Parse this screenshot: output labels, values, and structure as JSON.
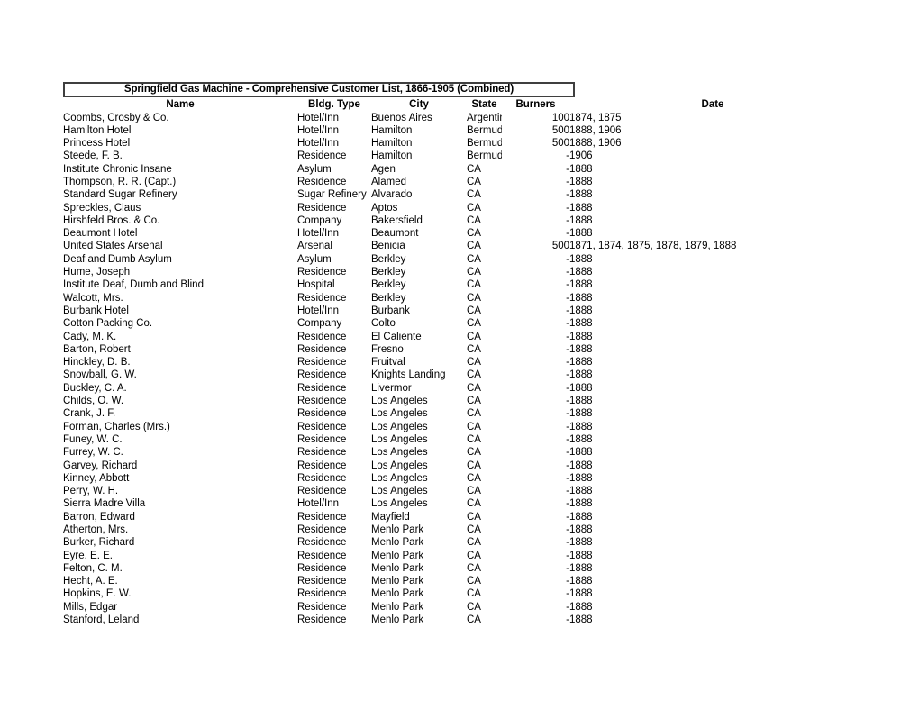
{
  "document": {
    "title": "Springfield Gas Machine - Comprehensive Customer List, 1866-1905 (Combined)"
  },
  "table": {
    "columns": [
      {
        "key": "name",
        "label": "Name"
      },
      {
        "key": "type",
        "label": "Bldg. Type"
      },
      {
        "key": "city",
        "label": "City"
      },
      {
        "key": "state",
        "label": "State"
      },
      {
        "key": "burners",
        "label": "Burners"
      },
      {
        "key": "date",
        "label": "Date"
      }
    ],
    "rows": [
      {
        "name": "Coombs, Crosby & Co.",
        "type": "Hotel/Inn",
        "city": "Buenos Aires",
        "state": "Argentina",
        "burners": "100",
        "date": "1874, 1875"
      },
      {
        "name": "Hamilton Hotel",
        "type": "Hotel/Inn",
        "city": "Hamilton",
        "state": "Bermuda",
        "burners": "500",
        "date": "1888, 1906"
      },
      {
        "name": "Princess Hotel",
        "type": "Hotel/Inn",
        "city": "Hamilton",
        "state": "Bermuda",
        "burners": "500",
        "date": "1888, 1906"
      },
      {
        "name": "Steede, F. B.",
        "type": "Residence",
        "city": "Hamilton",
        "state": "Bermuda",
        "burners": "-",
        "date": "1906"
      },
      {
        "name": "Institute Chronic Insane",
        "type": "Asylum",
        "city": "Agen",
        "state": "CA",
        "burners": "-",
        "date": "1888"
      },
      {
        "name": "Thompson, R. R. (Capt.)",
        "type": "Residence",
        "city": "Alamed",
        "state": "CA",
        "burners": "-",
        "date": "1888"
      },
      {
        "name": "Standard Sugar Refinery",
        "type": "Sugar Refinery",
        "city": "Alvarado",
        "state": "CA",
        "burners": "-",
        "date": "1888"
      },
      {
        "name": "Spreckles, Claus",
        "type": "Residence",
        "city": "Aptos",
        "state": "CA",
        "burners": "-",
        "date": "1888"
      },
      {
        "name": "Hirshfeld Bros. & Co.",
        "type": "Company",
        "city": "Bakersfield",
        "state": "CA",
        "burners": "-",
        "date": "1888"
      },
      {
        "name": "Beaumont Hotel",
        "type": "Hotel/Inn",
        "city": "Beaumont",
        "state": "CA",
        "burners": "-",
        "date": "1888"
      },
      {
        "name": "United States Arsenal",
        "type": "Arsenal",
        "city": "Benicia",
        "state": "CA",
        "burners": "500",
        "date": "1871, 1874, 1875, 1878, 1879, 1888"
      },
      {
        "name": "Deaf and Dumb Asylum",
        "type": "Asylum",
        "city": "Berkley",
        "state": "CA",
        "burners": "-",
        "date": "1888"
      },
      {
        "name": "Hume, Joseph",
        "type": "Residence",
        "city": "Berkley",
        "state": "CA",
        "burners": "-",
        "date": "1888"
      },
      {
        "name": "Institute Deaf, Dumb and Blind",
        "type": "Hospital",
        "city": "Berkley",
        "state": "CA",
        "burners": "-",
        "date": "1888"
      },
      {
        "name": "Walcott, Mrs.",
        "type": "Residence",
        "city": "Berkley",
        "state": "CA",
        "burners": "-",
        "date": "1888"
      },
      {
        "name": "Burbank Hotel",
        "type": "Hotel/Inn",
        "city": "Burbank",
        "state": "CA",
        "burners": "-",
        "date": "1888"
      },
      {
        "name": "Cotton Packing Co.",
        "type": "Company",
        "city": "Colto",
        "state": "CA",
        "burners": "-",
        "date": "1888"
      },
      {
        "name": "Cady, M. K.",
        "type": "Residence",
        "city": "El Caliente",
        "state": "CA",
        "burners": "-",
        "date": "1888"
      },
      {
        "name": "Barton, Robert",
        "type": "Residence",
        "city": "Fresno",
        "state": "CA",
        "burners": "-",
        "date": "1888"
      },
      {
        "name": "Hinckley, D. B.",
        "type": "Residence",
        "city": "Fruitval",
        "state": "CA",
        "burners": "-",
        "date": "1888"
      },
      {
        "name": "Snowball, G. W.",
        "type": "Residence",
        "city": "Knights Landing",
        "state": "CA",
        "burners": "-",
        "date": "1888"
      },
      {
        "name": "Buckley, C. A.",
        "type": "Residence",
        "city": "Livermor",
        "state": "CA",
        "burners": "-",
        "date": "1888"
      },
      {
        "name": "Childs, O. W.",
        "type": "Residence",
        "city": "Los Angeles",
        "state": "CA",
        "burners": "-",
        "date": "1888"
      },
      {
        "name": "Crank, J. F.",
        "type": "Residence",
        "city": "Los Angeles",
        "state": "CA",
        "burners": "-",
        "date": "1888"
      },
      {
        "name": "Forman, Charles (Mrs.)",
        "type": "Residence",
        "city": "Los Angeles",
        "state": "CA",
        "burners": "-",
        "date": "1888"
      },
      {
        "name": "Funey, W. C.",
        "type": "Residence",
        "city": "Los Angeles",
        "state": "CA",
        "burners": "-",
        "date": "1888"
      },
      {
        "name": "Furrey, W. C.",
        "type": "Residence",
        "city": "Los Angeles",
        "state": "CA",
        "burners": "-",
        "date": "1888"
      },
      {
        "name": "Garvey, Richard",
        "type": "Residence",
        "city": "Los Angeles",
        "state": "CA",
        "burners": "-",
        "date": "1888"
      },
      {
        "name": "Kinney, Abbott",
        "type": "Residence",
        "city": "Los Angeles",
        "state": "CA",
        "burners": "-",
        "date": "1888"
      },
      {
        "name": "Perry, W. H.",
        "type": "Residence",
        "city": "Los Angeles",
        "state": "CA",
        "burners": "-",
        "date": "1888"
      },
      {
        "name": "Sierra Madre Villa",
        "type": "Hotel/Inn",
        "city": "Los Angeles",
        "state": "CA",
        "burners": "-",
        "date": "1888"
      },
      {
        "name": "Barron, Edward",
        "type": "Residence",
        "city": "Mayfield",
        "state": "CA",
        "burners": "-",
        "date": "1888"
      },
      {
        "name": "Atherton, Mrs.",
        "type": "Residence",
        "city": "Menlo Park",
        "state": "CA",
        "burners": "-",
        "date": "1888"
      },
      {
        "name": "Burker, Richard",
        "type": "Residence",
        "city": "Menlo Park",
        "state": "CA",
        "burners": "-",
        "date": "1888"
      },
      {
        "name": "Eyre, E. E.",
        "type": "Residence",
        "city": "Menlo Park",
        "state": "CA",
        "burners": "-",
        "date": "1888"
      },
      {
        "name": "Felton, C. M.",
        "type": "Residence",
        "city": "Menlo Park",
        "state": "CA",
        "burners": "-",
        "date": "1888"
      },
      {
        "name": "Hecht, A. E.",
        "type": "Residence",
        "city": "Menlo Park",
        "state": "CA",
        "burners": "-",
        "date": "1888"
      },
      {
        "name": "Hopkins, E. W.",
        "type": "Residence",
        "city": "Menlo Park",
        "state": "CA",
        "burners": "-",
        "date": "1888"
      },
      {
        "name": "Mills, Edgar",
        "type": "Residence",
        "city": "Menlo Park",
        "state": "CA",
        "burners": "-",
        "date": "1888"
      },
      {
        "name": "Stanford, Leland",
        "type": "Residence",
        "city": "Menlo Park",
        "state": "CA",
        "burners": "-",
        "date": "1888"
      }
    ]
  }
}
